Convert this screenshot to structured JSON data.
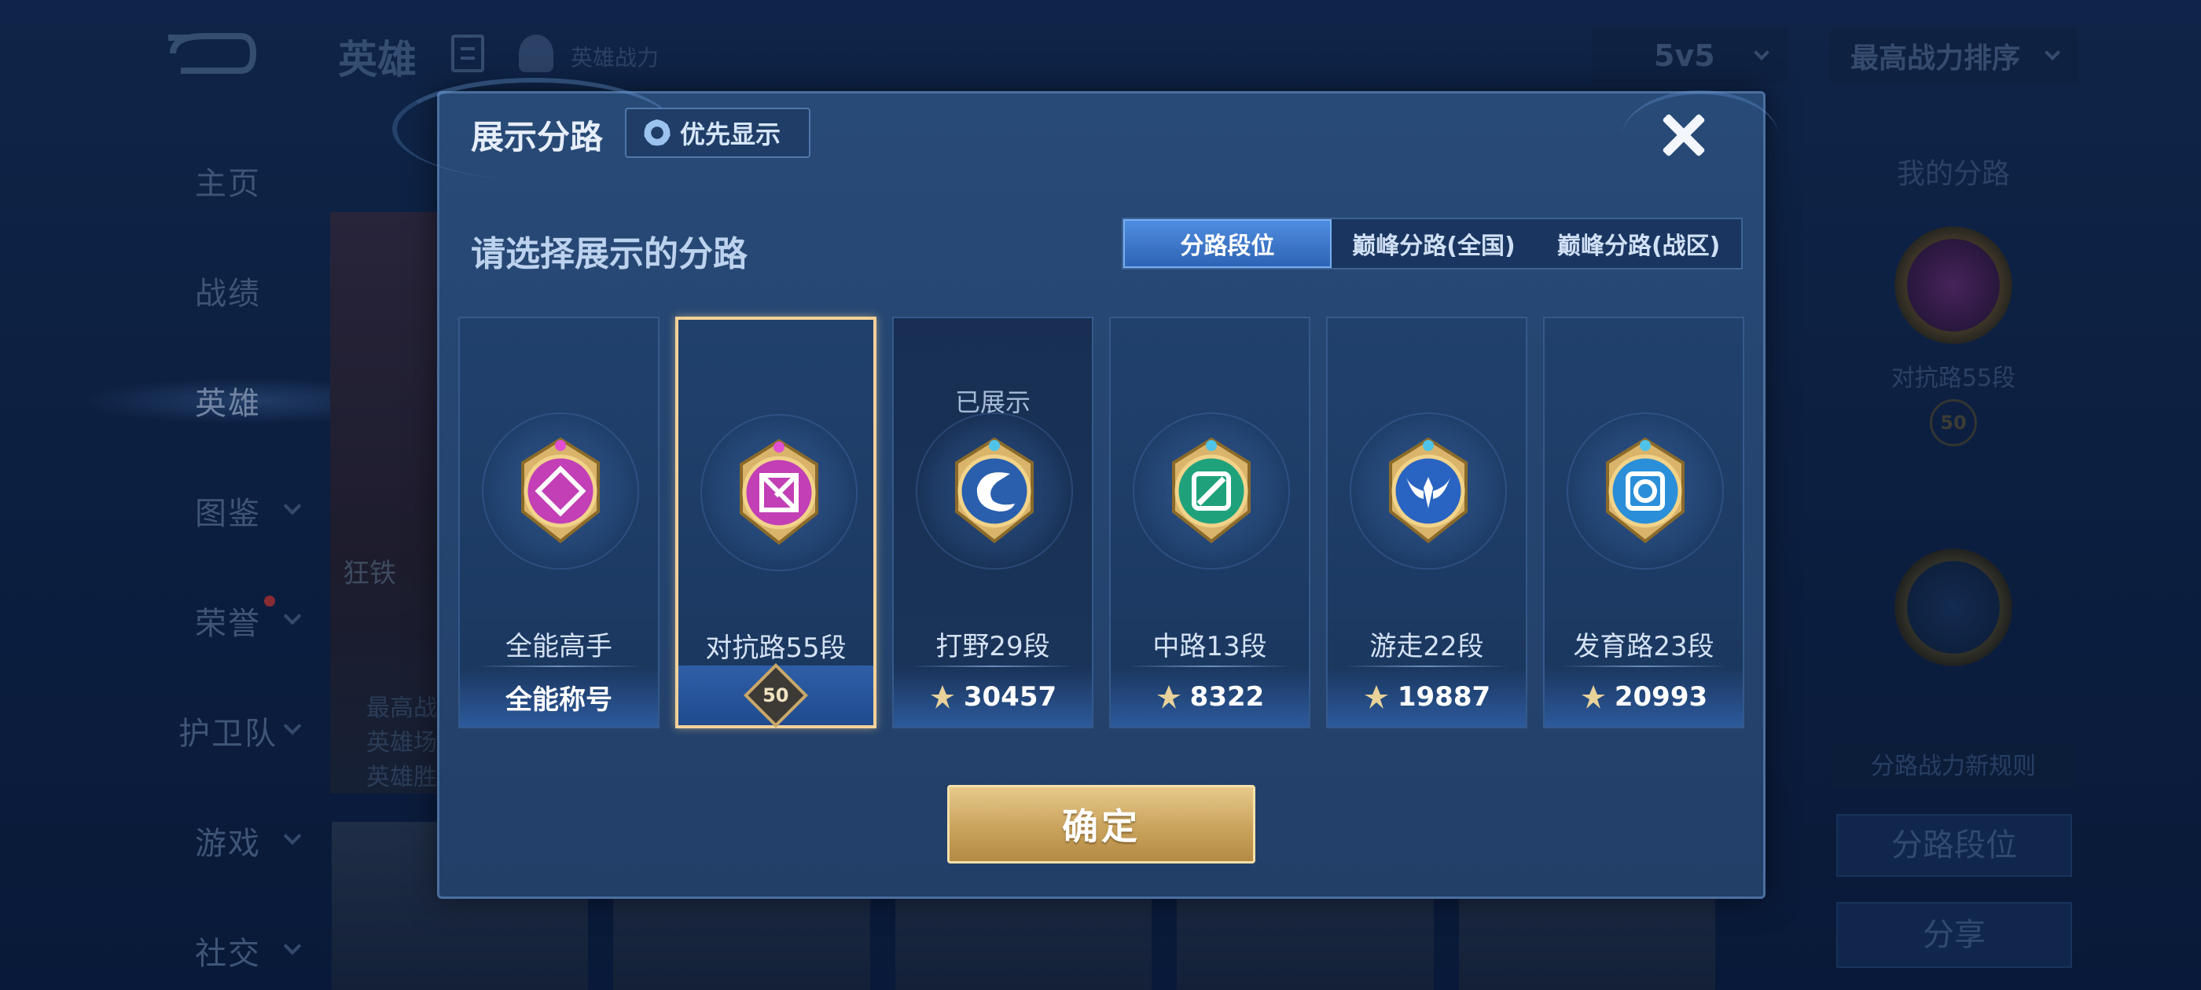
{
  "background": {
    "header": {
      "title": "英雄",
      "sub_label": "英雄战力",
      "mode_value": "5v5",
      "sort_value": "最高战力排序"
    },
    "sidebar": [
      {
        "label": "主页",
        "has_chevron": false
      },
      {
        "label": "战绩",
        "has_chevron": false
      },
      {
        "label": "英雄",
        "has_chevron": false,
        "active": true
      },
      {
        "label": "图鉴",
        "has_chevron": true
      },
      {
        "label": "荣誉",
        "has_chevron": true
      },
      {
        "label": "护卫队",
        "has_chevron": true
      },
      {
        "label": "游戏",
        "has_chevron": true
      },
      {
        "label": "社交",
        "has_chevron": true
      }
    ],
    "hero_card": {
      "name": "狂铁",
      "lines": [
        "最高战",
        "英雄场",
        "英雄胜"
      ]
    },
    "right_panel": {
      "title": "我的分路",
      "rank": "对抗路55段",
      "level": "50",
      "note": "分路战力新规则",
      "btn_rank": "分路段位",
      "btn_share": "分享"
    }
  },
  "modal": {
    "title": "展示分路",
    "priority_label": "优先显示",
    "subtitle": "请选择展示的分路",
    "tabs": [
      "分路段位",
      "巅峰分路(全国)",
      "巅峰分路(战区)"
    ],
    "active_tab": 0,
    "cards": [
      {
        "name": "all-round",
        "rank": "全能高手",
        "bottom": "全能称号",
        "kind": "title",
        "color": "#c23fb6",
        "icon": "all-round-icon"
      },
      {
        "name": "clash-lane",
        "rank": "对抗路55段",
        "bottom": "50",
        "kind": "level",
        "selected": true,
        "color": "#c23fb6",
        "icon": "clash-lane-icon"
      },
      {
        "name": "jungle",
        "rank": "打野29段",
        "bottom": "30457",
        "kind": "power",
        "shown_label": "已展示",
        "color": "#2a5fae",
        "icon": "jungle-dragon-icon"
      },
      {
        "name": "mid-lane",
        "rank": "中路13段",
        "bottom": "8322",
        "kind": "power",
        "color": "#1fa27c",
        "icon": "mid-lane-icon"
      },
      {
        "name": "roam",
        "rank": "游走22段",
        "bottom": "19887",
        "kind": "power",
        "color": "#2a64c2",
        "icon": "roam-wings-icon"
      },
      {
        "name": "farm-lane",
        "rank": "发育路23段",
        "bottom": "20993",
        "kind": "power",
        "color": "#2a8fd8",
        "icon": "farm-lane-icon"
      }
    ],
    "confirm_label": "确定"
  }
}
